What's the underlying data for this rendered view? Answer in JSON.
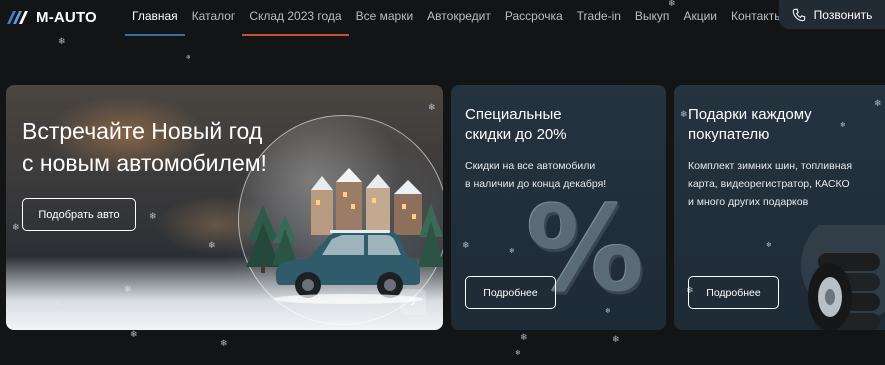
{
  "brand": {
    "name": "M-AUTO"
  },
  "nav": [
    {
      "label": "Главная"
    },
    {
      "label": "Каталог"
    },
    {
      "label": "Склад 2023 года"
    },
    {
      "label": "Все марки"
    },
    {
      "label": "Автокредит"
    },
    {
      "label": "Рассрочка"
    },
    {
      "label": "Trade-in"
    },
    {
      "label": "Выкуп"
    },
    {
      "label": "Акции"
    },
    {
      "label": "Контакты"
    }
  ],
  "call_button": {
    "label": "Позвонить",
    "icon": "phone-icon"
  },
  "hero": {
    "title_line1": "Встречайте Новый год",
    "title_line2": "с новым автомобилем!",
    "button_label": "Подобрать авто",
    "next_icon": "chevron-right-icon"
  },
  "promos": [
    {
      "title_line1": "Специальные",
      "title_line2": "скидки до 20%",
      "text_line1": "Скидки на все автомобили",
      "text_line2": "в наличии до конца декабря!",
      "button_label": "Подробнее",
      "graphic": "%"
    },
    {
      "title_line1": "Подарки каждому",
      "title_line2": "покупателю",
      "text_line1": "Комплект зимних шин, топливная",
      "text_line2": "карта, видеорегистратор, КАСКО",
      "text_line3": "и много других подарков",
      "button_label": "Подробнее"
    }
  ],
  "colors": {
    "background": "#121416",
    "nav_active_underline": "#3a6ea0",
    "nav_accent_underline": "#c8503a",
    "card": "#24333f",
    "call_button": "#222a33"
  },
  "snowflake_glyph": "❄"
}
